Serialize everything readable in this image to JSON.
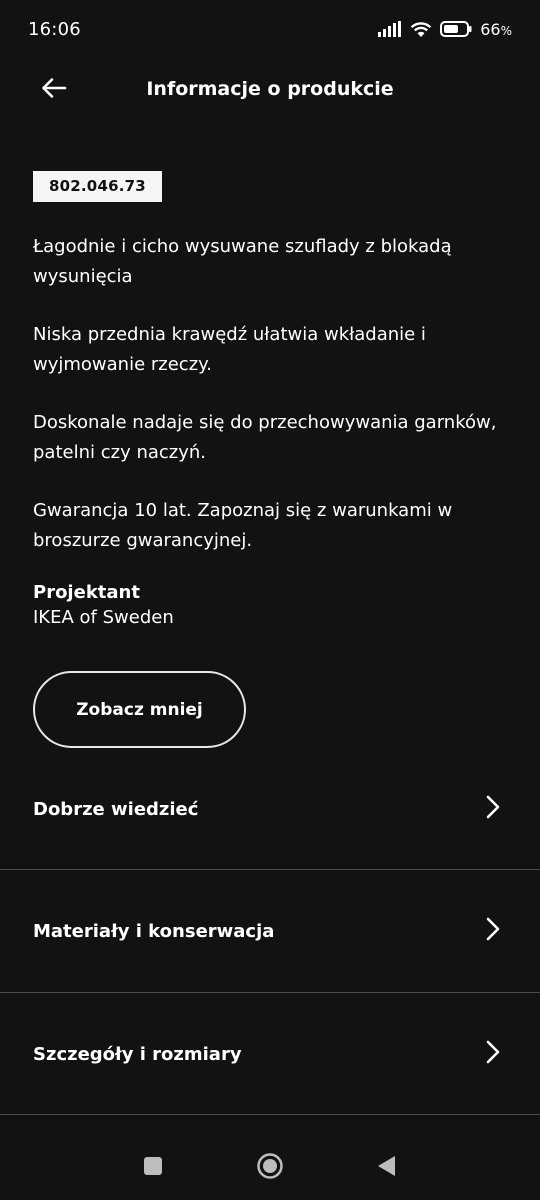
{
  "status_bar": {
    "time": "16:06",
    "battery": "66",
    "battery_unit": "%"
  },
  "header": {
    "title": "Informacje o produkcie",
    "back_icon": "arrow-left-icon"
  },
  "product": {
    "article_number": "802.046.73",
    "description": [
      "Łagodnie i cicho wysuwane szuflady z blokadą wysunięcia",
      "Niska przednia krawędź ułatwia wkładanie i wyjmowanie rzeczy.",
      "Doskonale nadaje się do przechowywania garnków, patelni czy naczyń.",
      "Gwarancja 10 lat. Zapoznaj się z warunkami w broszurze gwarancyjnej."
    ],
    "designer_label": "Projektant",
    "designer_value": "IKEA of Sweden",
    "toggle_label": "Zobacz mniej"
  },
  "sections": [
    {
      "label": "Dobrze wiedzieć",
      "icon": "chevron-right-icon"
    },
    {
      "label": "Materiały i konserwacja",
      "icon": "chevron-right-icon"
    },
    {
      "label": "Szczegóły i rozmiary",
      "icon": "chevron-right-icon"
    }
  ],
  "nav_bar": {
    "recents_icon": "square-icon",
    "home_icon": "circle-home-icon",
    "back_icon": "triangle-back-icon"
  },
  "colors": {
    "background": "#121212",
    "text": "#ffffff",
    "badge_bg": "#f5f5f5",
    "divider": "#4a4a4a"
  }
}
